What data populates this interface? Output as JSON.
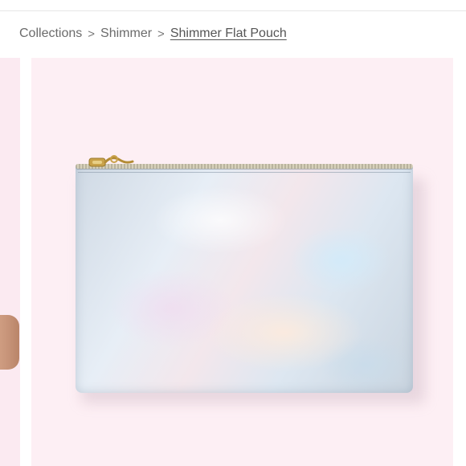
{
  "breadcrumb": {
    "items": [
      "Collections",
      "Shimmer"
    ],
    "separator": ">",
    "current": "Shimmer Flat Pouch"
  },
  "gallery": {
    "background_color": "#fdeff4",
    "product_image_icon": "iridescent-pouch"
  }
}
